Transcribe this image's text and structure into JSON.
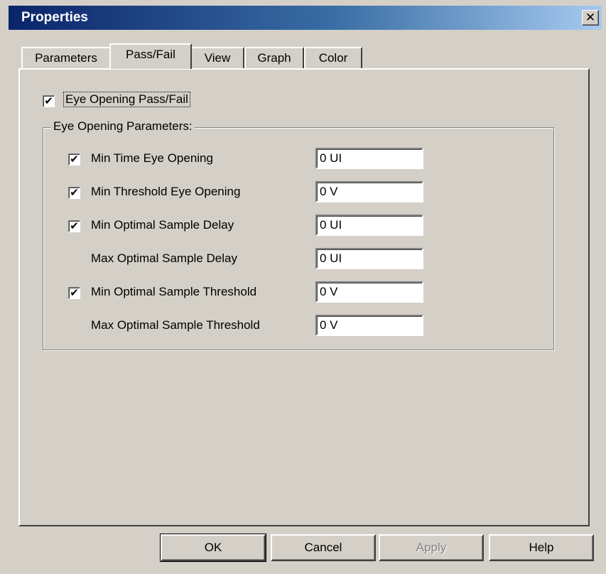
{
  "window": {
    "title": "Properties",
    "close_glyph": "✕"
  },
  "tabs": [
    {
      "label": "Parameters",
      "active": false
    },
    {
      "label": "Pass/Fail",
      "active": true
    },
    {
      "label": "View",
      "active": false
    },
    {
      "label": "Graph",
      "active": false
    },
    {
      "label": "Color",
      "active": false
    }
  ],
  "pass_fail": {
    "enable_label": "Eye Opening Pass/Fail",
    "enable_checked": true,
    "group_label": "Eye Opening Parameters:",
    "params": [
      {
        "label": "Min Time Eye Opening",
        "has_checkbox": true,
        "checked": true,
        "value": "0 UI"
      },
      {
        "label": "Min Threshold Eye Opening",
        "has_checkbox": true,
        "checked": true,
        "value": "0 V"
      },
      {
        "label": "Min Optimal Sample Delay",
        "has_checkbox": true,
        "checked": true,
        "value": "0 UI"
      },
      {
        "label": "Max Optimal Sample Delay",
        "has_checkbox": false,
        "checked": false,
        "value": "0 UI"
      },
      {
        "label": "Min Optimal Sample Threshold",
        "has_checkbox": true,
        "checked": true,
        "value": "0 V"
      },
      {
        "label": "Max Optimal Sample Threshold",
        "has_checkbox": false,
        "checked": false,
        "value": "0 V"
      }
    ]
  },
  "buttons": {
    "ok": "OK",
    "cancel": "Cancel",
    "apply": "Apply",
    "help": "Help"
  },
  "check_glyph": "✔",
  "colors": {
    "titlebar_start": "#0a246a",
    "titlebar_end": "#a6caf0",
    "face": "#d4d0c8"
  }
}
